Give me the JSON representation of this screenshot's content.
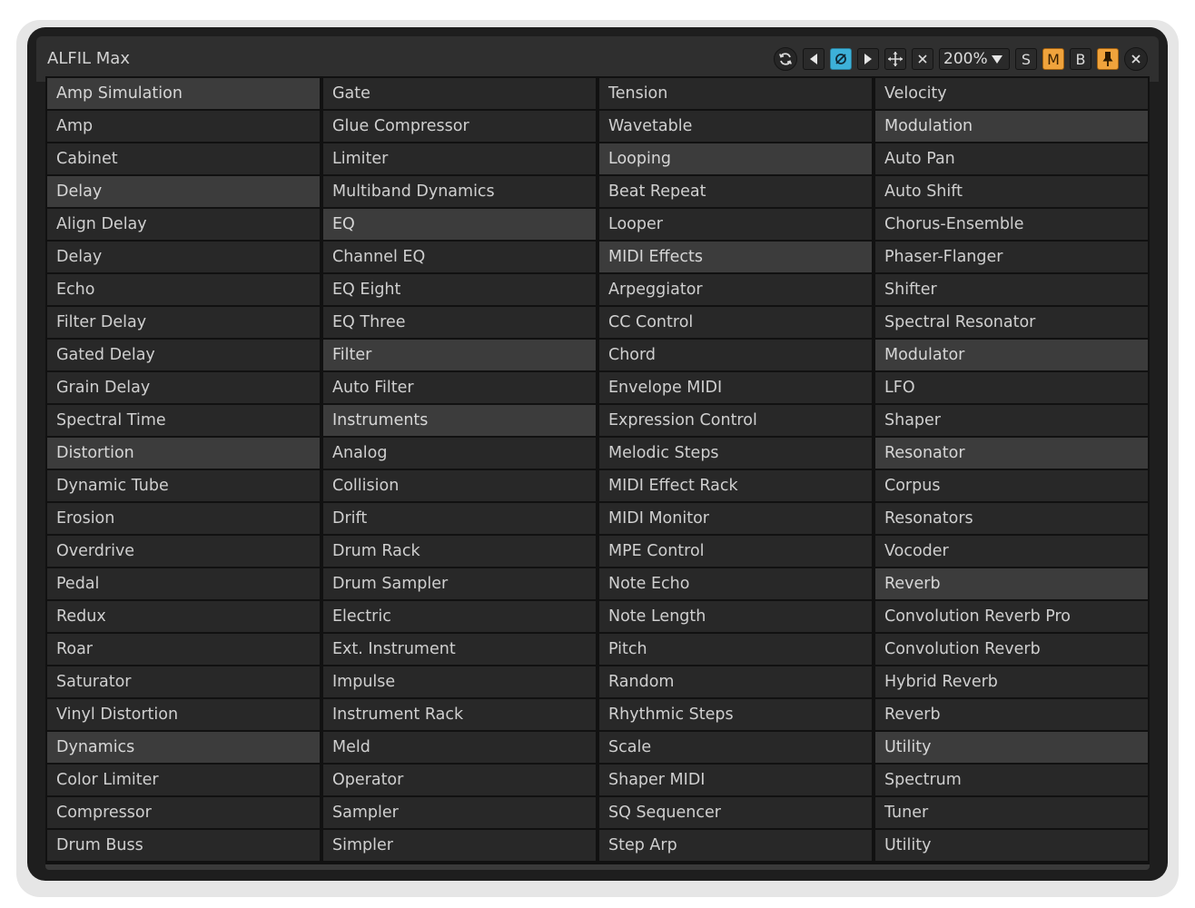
{
  "window": {
    "title": "ALFIL Max"
  },
  "toolbar": {
    "zoom_label": "200%",
    "s_label": "S",
    "m_label": "M",
    "b_label": "B",
    "icons": [
      "refresh-icon",
      "prev-icon",
      "deactivate-icon",
      "next-icon",
      "move-icon",
      "clear-icon",
      "pin-icon",
      "close-icon"
    ],
    "accent_color": "#3db1d9",
    "highlight_color": "#f0a33c"
  },
  "columns": [
    {
      "items": [
        {
          "label": "Amp Simulation",
          "header": true
        },
        {
          "label": "Amp",
          "header": false
        },
        {
          "label": "Cabinet",
          "header": false
        },
        {
          "label": "Delay",
          "header": true
        },
        {
          "label": "Align Delay",
          "header": false
        },
        {
          "label": "Delay",
          "header": false
        },
        {
          "label": "Echo",
          "header": false
        },
        {
          "label": "Filter Delay",
          "header": false
        },
        {
          "label": "Gated Delay",
          "header": false
        },
        {
          "label": "Grain Delay",
          "header": false
        },
        {
          "label": "Spectral Time",
          "header": false
        },
        {
          "label": "Distortion",
          "header": true
        },
        {
          "label": "Dynamic Tube",
          "header": false
        },
        {
          "label": "Erosion",
          "header": false
        },
        {
          "label": "Overdrive",
          "header": false
        },
        {
          "label": "Pedal",
          "header": false
        },
        {
          "label": "Redux",
          "header": false
        },
        {
          "label": "Roar",
          "header": false
        },
        {
          "label": "Saturator",
          "header": false
        },
        {
          "label": "Vinyl Distortion",
          "header": false
        },
        {
          "label": "Dynamics",
          "header": true
        },
        {
          "label": "Color Limiter",
          "header": false
        },
        {
          "label": "Compressor",
          "header": false
        },
        {
          "label": "Drum Buss",
          "header": false
        }
      ]
    },
    {
      "items": [
        {
          "label": "Gate",
          "header": false
        },
        {
          "label": "Glue Compressor",
          "header": false
        },
        {
          "label": "Limiter",
          "header": false
        },
        {
          "label": "Multiband Dynamics",
          "header": false
        },
        {
          "label": "EQ",
          "header": true
        },
        {
          "label": "Channel EQ",
          "header": false
        },
        {
          "label": "EQ Eight",
          "header": false
        },
        {
          "label": "EQ Three",
          "header": false
        },
        {
          "label": "Filter",
          "header": true
        },
        {
          "label": "Auto Filter",
          "header": false
        },
        {
          "label": "Instruments",
          "header": true
        },
        {
          "label": "Analog",
          "header": false
        },
        {
          "label": "Collision",
          "header": false
        },
        {
          "label": "Drift",
          "header": false
        },
        {
          "label": "Drum Rack",
          "header": false
        },
        {
          "label": "Drum Sampler",
          "header": false
        },
        {
          "label": "Electric",
          "header": false
        },
        {
          "label": "Ext. Instrument",
          "header": false
        },
        {
          "label": "Impulse",
          "header": false
        },
        {
          "label": "Instrument Rack",
          "header": false
        },
        {
          "label": "Meld",
          "header": false
        },
        {
          "label": "Operator",
          "header": false
        },
        {
          "label": "Sampler",
          "header": false
        },
        {
          "label": "Simpler",
          "header": false
        }
      ]
    },
    {
      "items": [
        {
          "label": "Tension",
          "header": false
        },
        {
          "label": "Wavetable",
          "header": false
        },
        {
          "label": "Looping",
          "header": true
        },
        {
          "label": "Beat Repeat",
          "header": false
        },
        {
          "label": "Looper",
          "header": false
        },
        {
          "label": "MIDI Effects",
          "header": true
        },
        {
          "label": "Arpeggiator",
          "header": false
        },
        {
          "label": "CC Control",
          "header": false
        },
        {
          "label": "Chord",
          "header": false
        },
        {
          "label": "Envelope MIDI",
          "header": false
        },
        {
          "label": "Expression Control",
          "header": false
        },
        {
          "label": "Melodic Steps",
          "header": false
        },
        {
          "label": "MIDI Effect Rack",
          "header": false
        },
        {
          "label": "MIDI Monitor",
          "header": false
        },
        {
          "label": "MPE Control",
          "header": false
        },
        {
          "label": "Note Echo",
          "header": false
        },
        {
          "label": "Note Length",
          "header": false
        },
        {
          "label": "Pitch",
          "header": false
        },
        {
          "label": "Random",
          "header": false
        },
        {
          "label": "Rhythmic Steps",
          "header": false
        },
        {
          "label": "Scale",
          "header": false
        },
        {
          "label": "Shaper MIDI",
          "header": false
        },
        {
          "label": "SQ Sequencer",
          "header": false
        },
        {
          "label": "Step Arp",
          "header": false
        }
      ]
    },
    {
      "items": [
        {
          "label": "Velocity",
          "header": false
        },
        {
          "label": "Modulation",
          "header": true
        },
        {
          "label": "Auto Pan",
          "header": false
        },
        {
          "label": "Auto Shift",
          "header": false
        },
        {
          "label": "Chorus-Ensemble",
          "header": false
        },
        {
          "label": "Phaser-Flanger",
          "header": false
        },
        {
          "label": "Shifter",
          "header": false
        },
        {
          "label": "Spectral Resonator",
          "header": false
        },
        {
          "label": "Modulator",
          "header": true
        },
        {
          "label": "LFO",
          "header": false
        },
        {
          "label": "Shaper",
          "header": false
        },
        {
          "label": "Resonator",
          "header": true
        },
        {
          "label": "Corpus",
          "header": false
        },
        {
          "label": "Resonators",
          "header": false
        },
        {
          "label": "Vocoder",
          "header": false
        },
        {
          "label": "Reverb",
          "header": true
        },
        {
          "label": "Convolution Reverb Pro",
          "header": false
        },
        {
          "label": "Convolution Reverb",
          "header": false
        },
        {
          "label": "Hybrid Reverb",
          "header": false
        },
        {
          "label": "Reverb",
          "header": false
        },
        {
          "label": "Utility",
          "header": true
        },
        {
          "label": "Spectrum",
          "header": false
        },
        {
          "label": "Tuner",
          "header": false
        },
        {
          "label": "Utility",
          "header": false
        }
      ]
    }
  ]
}
